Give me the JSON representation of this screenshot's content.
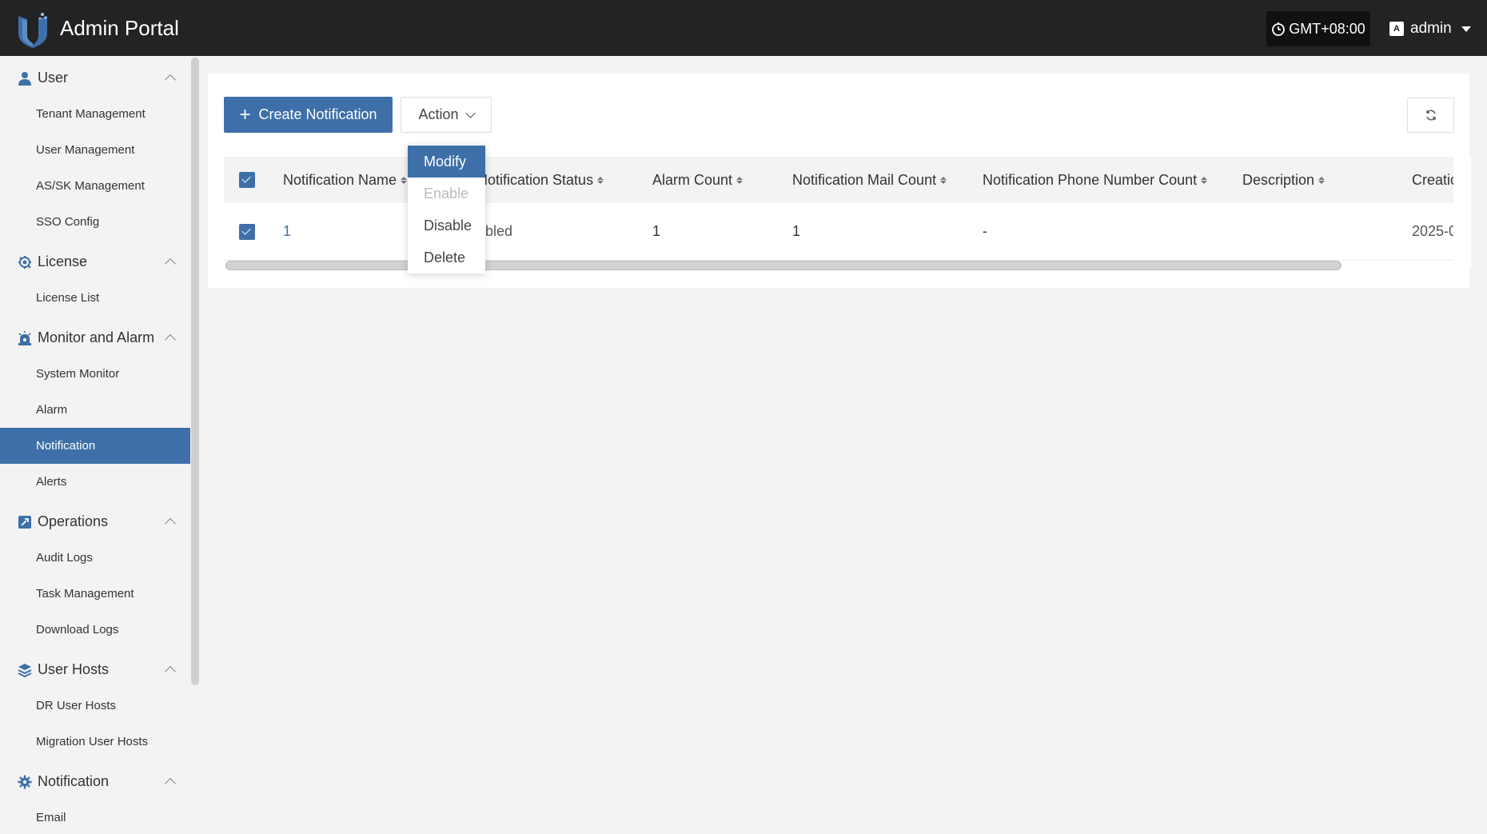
{
  "header": {
    "app_title": "Admin Portal",
    "timezone": "GMT+08:00",
    "user": "admin",
    "lang_icon": "language-icon"
  },
  "sidebar": {
    "groups": [
      {
        "label": "User",
        "icon": "user-icon",
        "items": [
          "Tenant Management",
          "User Management",
          "AS/SK Management",
          "SSO Config"
        ]
      },
      {
        "label": "License",
        "icon": "license-icon",
        "items": [
          "License List"
        ]
      },
      {
        "label": "Monitor and Alarm",
        "icon": "alarm-icon",
        "items": [
          "System Monitor",
          "Alarm",
          "Notification",
          "Alerts"
        ]
      },
      {
        "label": "Operations",
        "icon": "operations-icon",
        "items": [
          "Audit Logs",
          "Task Management",
          "Download Logs"
        ]
      },
      {
        "label": "User Hosts",
        "icon": "layers-icon",
        "items": [
          "DR User Hosts",
          "Migration User Hosts"
        ]
      },
      {
        "label": "Notification",
        "icon": "gear-icon",
        "items": [
          "Email"
        ]
      }
    ],
    "active_item": "Notification"
  },
  "toolbar": {
    "create_label": "Create Notification",
    "action_label": "Action"
  },
  "table": {
    "columns": [
      "Notification Name",
      "Notification Status",
      "Alarm Count",
      "Notification Mail Count",
      "Notification Phone Number Count",
      "Description",
      "Creatic"
    ],
    "rows": [
      {
        "name": "1",
        "status": "abled",
        "alarm_count": "1",
        "mail_count": "1",
        "phone_count": "-",
        "description": "",
        "creation": "2025-0"
      }
    ]
  },
  "action_menu": {
    "items": [
      {
        "label": "Modify",
        "state": "active"
      },
      {
        "label": "Enable",
        "state": "disabled"
      },
      {
        "label": "Disable",
        "state": "normal"
      },
      {
        "label": "Delete",
        "state": "normal"
      }
    ]
  },
  "colors": {
    "accent": "#3e6fa8",
    "header_bg": "#232323"
  }
}
